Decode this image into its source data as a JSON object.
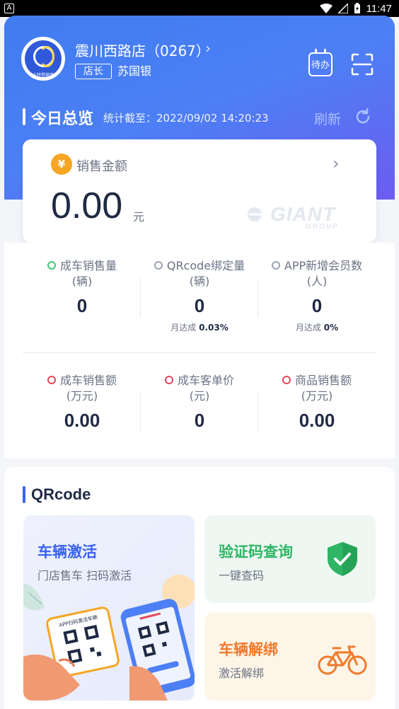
{
  "status_bar": {
    "left_glyph": "A",
    "time": "11:47"
  },
  "header": {
    "avatar_caption": "连云特授营旗舰店",
    "store_name": "震川西路店（0267）",
    "role": "店长",
    "manager": "苏国银",
    "todo_label": "待办"
  },
  "today": {
    "title": "今日总览",
    "stat_time": "统计截至：2022/09/02 14:20:23",
    "refresh": "刷新"
  },
  "sales": {
    "label": "销售金额",
    "value": "0.00",
    "unit": "元",
    "brand": "GIANT",
    "brand_sub": "GROUP"
  },
  "stats": [
    {
      "label": "成车销售量",
      "unit": "(辆)",
      "value": "0",
      "sub_prefix": "",
      "sub_value": "",
      "dot": "green"
    },
    {
      "label": "QRcode绑定量",
      "unit": "(辆)",
      "value": "0",
      "sub_prefix": "月达成",
      "sub_value": "0.03%",
      "dot": "gray"
    },
    {
      "label": "APP新增会员数",
      "unit": "(人)",
      "value": "0",
      "sub_prefix": "月达成",
      "sub_value": "0%",
      "dot": "gray"
    },
    {
      "label": "成车销售额",
      "unit": "(万元)",
      "value": "0.00",
      "dot": "red"
    },
    {
      "label": "成车客单价",
      "unit": "(元)",
      "value": "0",
      "dot": "red"
    },
    {
      "label": "商品销售额",
      "unit": "(万元)",
      "value": "0.00",
      "dot": "red"
    }
  ],
  "qrcode": {
    "title": "QRcode",
    "activate": {
      "title": "车辆激活",
      "sub": "门店售车 扫码激活",
      "card_text": "APP扫码激活车辆"
    },
    "verify": {
      "title": "验证码查询",
      "sub": "一键查码"
    },
    "unbind": {
      "title": "车辆解绑",
      "sub": "激活解绑"
    }
  },
  "colors": {
    "primary": "#3f7cf0",
    "green": "#2fb565",
    "orange": "#f07a2c",
    "gold": "#f5a623"
  }
}
